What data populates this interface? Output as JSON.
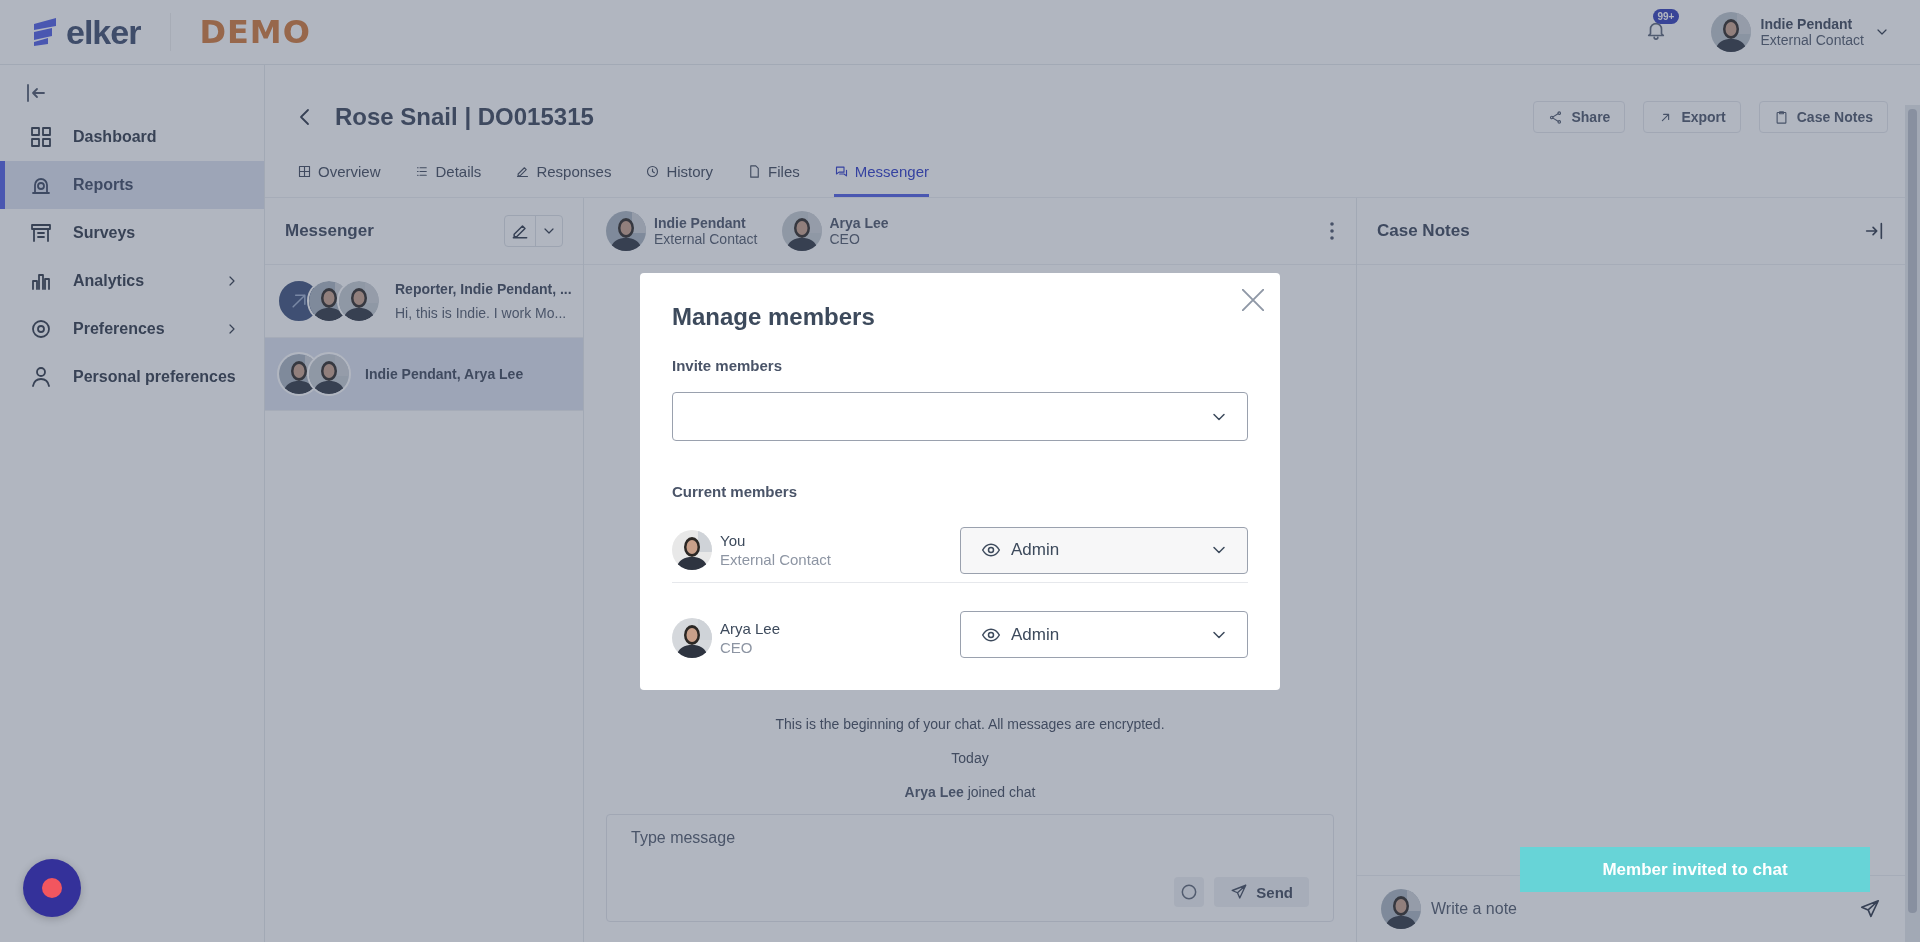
{
  "topbar": {
    "logo": "elker",
    "environment": "DEMO",
    "notification_count": "99+",
    "user": {
      "name": "Indie Pendant",
      "role": "External Contact"
    }
  },
  "sidebar": {
    "items": [
      {
        "label": "Dashboard",
        "selected": false,
        "has_submenu": false
      },
      {
        "label": "Reports",
        "selected": true,
        "has_submenu": false
      },
      {
        "label": "Surveys",
        "selected": false,
        "has_submenu": false
      },
      {
        "label": "Analytics",
        "selected": false,
        "has_submenu": true
      },
      {
        "label": "Preferences",
        "selected": false,
        "has_submenu": true
      },
      {
        "label": "Personal preferences",
        "selected": false,
        "has_submenu": false
      }
    ]
  },
  "case": {
    "title": "Rose Snail | DO015315",
    "actions": [
      "Share",
      "Export",
      "Case Notes"
    ],
    "tabs": [
      {
        "label": "Overview",
        "selected": false
      },
      {
        "label": "Details",
        "selected": false
      },
      {
        "label": "Responses",
        "selected": false
      },
      {
        "label": "History",
        "selected": false
      },
      {
        "label": "Files",
        "selected": false
      },
      {
        "label": "Messenger",
        "selected": true
      }
    ]
  },
  "messenger": {
    "title": "Messenger",
    "conversations": [
      {
        "title": "Reporter, Indie Pendant, ...",
        "preview": "Hi, this is Indie. I work Mo...",
        "selected": false
      },
      {
        "title": "Indie Pendant, Arya Lee",
        "selected": true
      }
    ]
  },
  "chat": {
    "participants": [
      {
        "name": "Indie Pendant",
        "role": "External Contact"
      },
      {
        "name": "Arya Lee",
        "role": "CEO"
      }
    ],
    "notice": "This is the beginning of your chat. All messages are encrypted.",
    "date": "Today",
    "event": "**Arya Lee** joined chat",
    "composer": {
      "placeholder": "Type message",
      "send": "Send"
    }
  },
  "case_notes": {
    "title": "Case Notes",
    "placeholder": "Write a note"
  },
  "modal": {
    "title": "Manage members",
    "invite_label": "Invite members",
    "current_label": "Current members",
    "members": [
      {
        "name": "You",
        "role": "External Contact",
        "permission": "Admin"
      },
      {
        "name": "Arya Lee",
        "role": "CEO",
        "permission": "Admin"
      }
    ]
  },
  "toast": "Member invited to chat"
}
